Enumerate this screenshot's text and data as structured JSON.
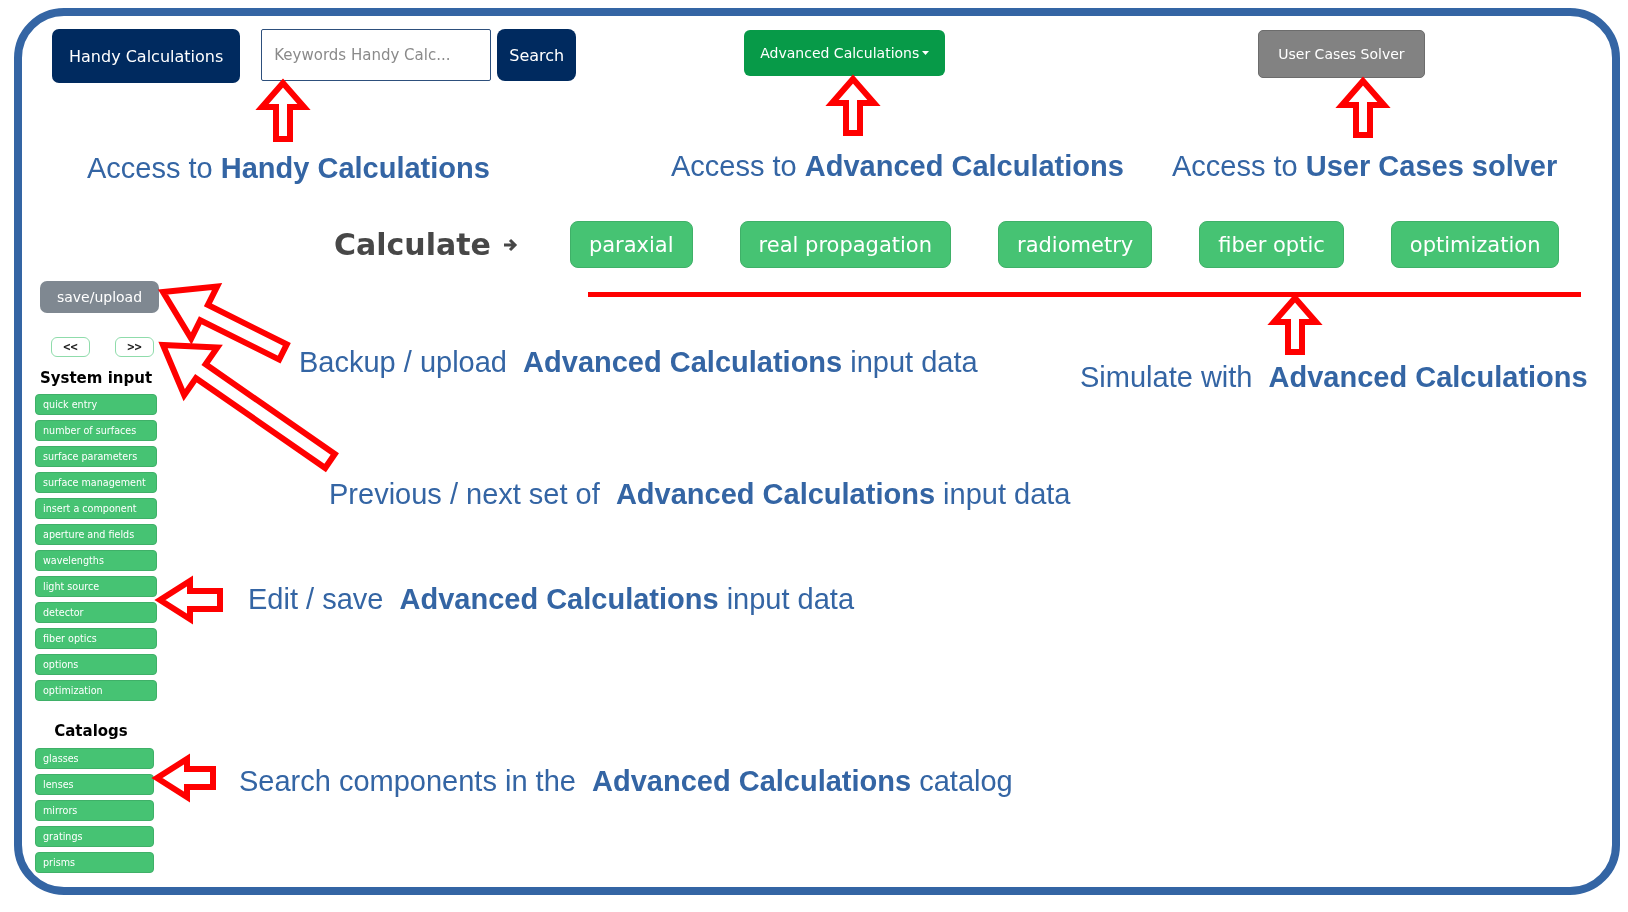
{
  "header": {
    "home_button": "Handy Calculations",
    "search": {
      "placeholder": "Keywords Handy Calc...",
      "button": "Search"
    },
    "advanced_menu": "Advanced Calculations",
    "solver_button": "User Cases Solver"
  },
  "calculate": {
    "label": "Calculate",
    "buttons": [
      "paraxial",
      "real propagation",
      "radiometry",
      "fiber optic",
      "optimization"
    ]
  },
  "sidebar": {
    "save_button": "save/upload",
    "previous": "<<",
    "next": ">>",
    "system_input": {
      "title": "System input",
      "items": [
        "quick entry",
        "number of surfaces",
        "surface parameters",
        "surface management",
        "insert a component",
        "aperture and fields",
        "wavelengths",
        "light source",
        "detector",
        "fiber optics",
        "options",
        "optimization"
      ]
    },
    "catalogs": {
      "title": "Catalogs",
      "items": [
        "glasses",
        "lenses",
        "mirrors",
        "gratings",
        "prisms"
      ]
    }
  },
  "annotations": [
    {
      "text": "Access to **Handy Calculations**",
      "kind": "up"
    },
    {
      "text": "Access to **Advanced Calculations**",
      "kind": "up"
    },
    {
      "text": "Access to **User Cases solver**",
      "kind": "up"
    },
    {
      "text": "Simulate with  **Advanced Calculations**",
      "kind": "up"
    },
    {
      "text": "Backup / upload  **Advanced Calculations** input data",
      "kind": "diagonal"
    },
    {
      "text": "Previous / next set of  **Advanced Calculations** input data",
      "kind": "diagonal"
    },
    {
      "text": "Edit / save  **Advanced Calculations** input data",
      "kind": "left"
    },
    {
      "text": "Search components in the  **Advanced Calculations** catalog",
      "kind": "left"
    }
  ]
}
